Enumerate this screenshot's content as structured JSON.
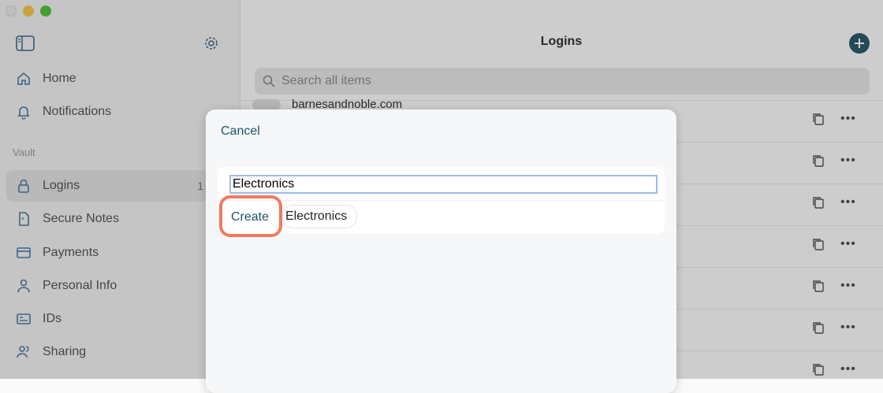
{
  "sidebar": {
    "section_vault": "Vault",
    "items": [
      {
        "label": "Home",
        "icon": "home-icon"
      },
      {
        "label": "Notifications",
        "icon": "bell-icon"
      },
      {
        "label": "Logins",
        "icon": "lock-icon",
        "count": "1"
      },
      {
        "label": "Secure Notes",
        "icon": "note-icon"
      },
      {
        "label": "Payments",
        "icon": "card-icon"
      },
      {
        "label": "Personal Info",
        "icon": "person-icon"
      },
      {
        "label": "IDs",
        "icon": "id-card-icon"
      },
      {
        "label": "Sharing",
        "icon": "people-icon"
      }
    ]
  },
  "main": {
    "title": "Logins",
    "search_placeholder": "Search all items",
    "first_item_title": "barnesandnoble.com"
  },
  "modal": {
    "cancel_label": "Cancel",
    "input_value": "Electronics",
    "create_label": "Create",
    "suggestion_label": "Electronics"
  },
  "colors": {
    "accent": "#1e5566",
    "highlight": "#f2795f",
    "add_button": "#2e5b6b"
  }
}
